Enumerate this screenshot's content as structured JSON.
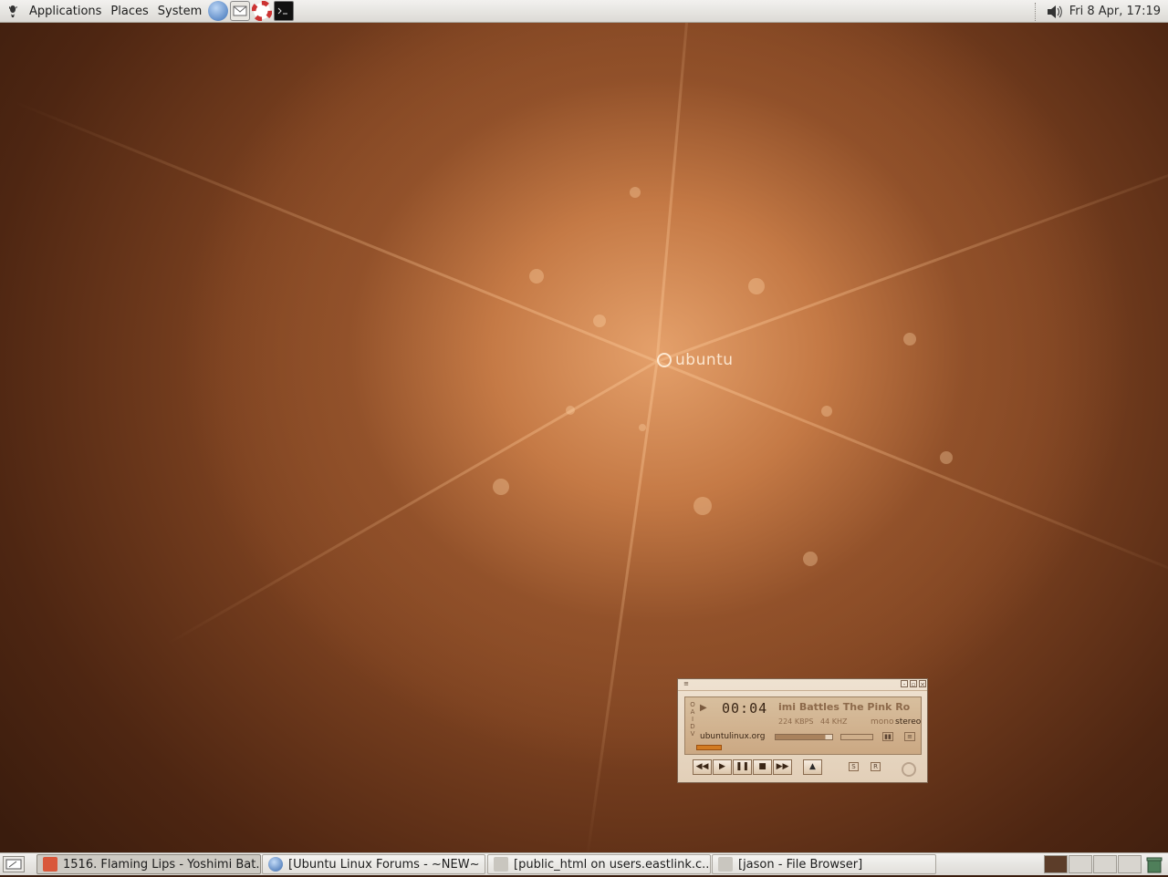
{
  "top_panel": {
    "menus": [
      "Applications",
      "Places",
      "System"
    ],
    "launchers": [
      "browser-icon",
      "mail-icon",
      "help-icon",
      "terminal-icon"
    ],
    "clock": "Fri  8 Apr, 17:19"
  },
  "desktop": {
    "logo_text": "ubuntu"
  },
  "player": {
    "vis_letters": "O A I D V",
    "time": "00:04",
    "song_title": "imi Battles The Pink Ro",
    "bitrate": "224",
    "bitrate_unit": "KBPS",
    "samplerate": "44",
    "samplerate_unit": "KHZ",
    "mono": "mono",
    "stereo": "stereo",
    "site": "ubuntulinux.org",
    "volume_level": 0.88,
    "controls": [
      "◀◀",
      "▶",
      "❚❚",
      "■",
      "▶▶"
    ],
    "eject": "▲",
    "shuffle": "S",
    "repeat": "R",
    "eq_label": "EQ",
    "pl_label": "PL"
  },
  "taskbar": {
    "tasks": [
      {
        "label": "1516. Flaming Lips - Yoshimi Bat...",
        "active": true
      },
      {
        "label": "[Ubuntu Linux Forums - ~NEW~ ...",
        "active": false
      },
      {
        "label": "[public_html on users.eastlink.c...",
        "active": false
      },
      {
        "label": "[jason - File Browser]",
        "active": false
      }
    ],
    "workspaces": 4,
    "active_workspace": 1
  },
  "colors": {
    "accent_orange": "#d27b22",
    "desktop_brown": "#7b4120"
  }
}
